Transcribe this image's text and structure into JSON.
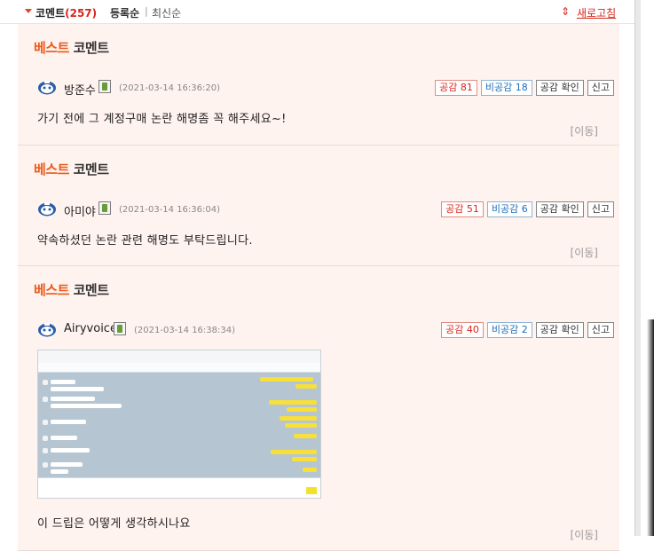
{
  "header": {
    "title": "코멘트",
    "count": "(257)",
    "sort_registered": "등록순",
    "sort_separator": "|",
    "sort_latest": "최신순",
    "refresh_label": "새로고침"
  },
  "best_label": {
    "part1": "베스트",
    "part2": " 코멘트"
  },
  "comments": [
    {
      "nickname": "방준수",
      "date": "(2021-03-14 16:36:20)",
      "like_label": "공감 81",
      "dislike_label": "비공감 18",
      "check_label": "공감 확인",
      "report_label": "신고",
      "text": "가기 전에 그 계정구매 논란 해명좀 꼭 해주세요~!",
      "move_label": "[이동]"
    },
    {
      "nickname": "아미야",
      "date": "(2021-03-14 16:36:04)",
      "like_label": "공감 51",
      "dislike_label": "비공감 6",
      "check_label": "공감 확인",
      "report_label": "신고",
      "text": "약속하셨던 논란 관련 해명도 부탁드립니다.",
      "move_label": "[이동]"
    },
    {
      "nickname": "Airyvoice",
      "date": "(2021-03-14 16:38:34)",
      "like_label": "공감 40",
      "dislike_label": "비공감 2",
      "check_label": "공감 확인",
      "report_label": "신고",
      "text": "이 드립은 어떻게 생각하시나요",
      "move_label": "[이동]"
    }
  ],
  "colors": {
    "accent": "#d9261c",
    "best_orange": "#ea5a1b",
    "comment_bg": "#fff3ef"
  }
}
